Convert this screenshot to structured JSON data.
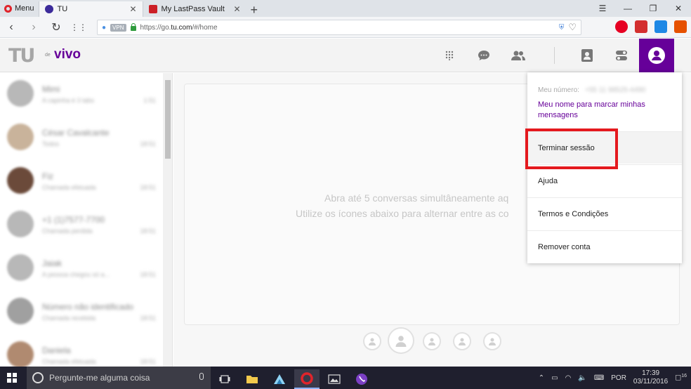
{
  "browser": {
    "menu_label": "Menu",
    "tabs": [
      {
        "title": "TU"
      },
      {
        "title": "My LastPass Vault"
      }
    ],
    "url_prefix": "https://go.",
    "url_domain": "tu.com",
    "url_path": "/#/home",
    "vpn_label": "VPN"
  },
  "app": {
    "logo_tu": "TU",
    "logo_de": "de",
    "logo_vivo": "vivo"
  },
  "contacts": [
    {
      "name": "Mimi",
      "message": "A capinha é 3 tabs",
      "time": "1:51"
    },
    {
      "name": "César Cavalcante",
      "message": "Todos",
      "time": "18:51"
    },
    {
      "name": "Fiz",
      "message": "Chamada efetuada",
      "time": "18:51"
    },
    {
      "name": "+1 (1)7577-7700",
      "message": "Chamada perdida",
      "time": "18:51"
    },
    {
      "name": "Jaiak",
      "message": "A pessoa chegou só a...",
      "time": "18:51"
    },
    {
      "name": "Número não identificado",
      "message": "Chamada recebida",
      "time": "18:51"
    },
    {
      "name": "Daniela",
      "message": "Chamada efetuada",
      "time": "18:51"
    }
  ],
  "main": {
    "placeholder_line1": "Abra até 5 conversas simultâneamente aq",
    "placeholder_line2": "Utilize os ícones abaixo para alternar entre as co"
  },
  "dropdown": {
    "number_label": "Meu número:",
    "number_value": "+55 11 98525-4490",
    "name_link": "Meu nome para marcar minhas mensagens",
    "items": [
      {
        "label": "Terminar sessão"
      },
      {
        "label": "Ajuda"
      },
      {
        "label": "Termos e Condições"
      },
      {
        "label": "Remover conta"
      }
    ]
  },
  "taskbar": {
    "search_placeholder": "Pergunte-me alguma coisa",
    "language": "POR",
    "time": "17:39",
    "date": "03/11/2016",
    "notifications": "16"
  },
  "colors": {
    "brand_purple": "#660099",
    "highlight_red": "#e4191e",
    "taskbar_bg": "#1f1f2e"
  }
}
